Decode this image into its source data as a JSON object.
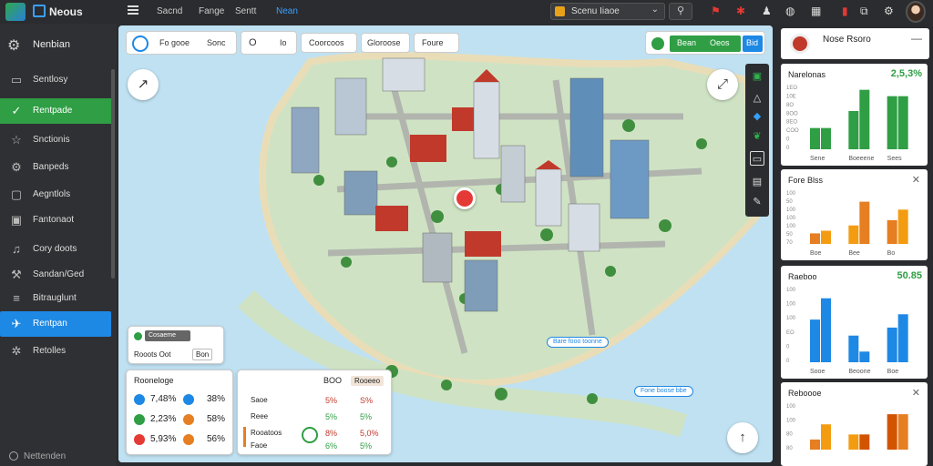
{
  "app": {
    "title": "Neous",
    "logo_color": "#2fa84f",
    "accent": "#1e88e5"
  },
  "topnav": [
    {
      "label": "Sacnd",
      "active": false
    },
    {
      "label": "Fange",
      "active": false
    },
    {
      "label": "Sentt",
      "active": false
    },
    {
      "label": "Nean",
      "active": true
    }
  ],
  "dropdown": {
    "value": "Scenu Iiaoe"
  },
  "sidebar": {
    "header": "Nenbian",
    "items": [
      {
        "label": "Sentlosy",
        "icon": "display-icon",
        "state": "normal"
      },
      {
        "label": "Rentpade",
        "icon": "shield-check-icon",
        "state": "green"
      },
      {
        "label": "Snctionis",
        "icon": "star-icon",
        "state": "normal"
      },
      {
        "label": "Banpeds",
        "icon": "gear-icon",
        "state": "normal"
      },
      {
        "label": "Aegntlols",
        "icon": "frame-icon",
        "state": "normal"
      },
      {
        "label": "Fantonaot",
        "icon": "square-icon",
        "state": "normal"
      },
      {
        "label": "Cory doots",
        "icon": "bell-icon",
        "state": "normal"
      },
      {
        "label": "Sandan/Ged",
        "icon": "tool-icon",
        "state": "normal"
      },
      {
        "label": "Bitrauglunt",
        "icon": "lines-icon",
        "state": "normal"
      },
      {
        "label": "Rentpan",
        "icon": "plane-icon",
        "state": "blue"
      },
      {
        "label": "Retolles",
        "icon": "settings-icon",
        "state": "normal"
      }
    ],
    "footer": "Nettenden"
  },
  "map_toolbar": {
    "pill1": {
      "a": "Fo gooe",
      "b": "Sonc"
    },
    "pill2": {
      "a": "O",
      "b": "Io"
    },
    "pill3": "Coorcoos",
    "pill4": "Gloroose",
    "pill5": "Foure",
    "toggle": {
      "a": "Bean",
      "b": "Oeos",
      "c": "Bid"
    }
  },
  "map_labels": [
    "Bare fooo toonne",
    "Fone boose bbe"
  ],
  "legend_card": {
    "badge": "Cosaeme boos",
    "a": "Rooots Oot",
    "b": "Bon"
  },
  "stats_card": {
    "title": "Rooneloge",
    "rows": [
      {
        "left": "7,48%",
        "right": "38%",
        "icon_left": "#1e88e5",
        "icon_right": "#1e88e5"
      },
      {
        "left": "2,23%",
        "right": "58%",
        "icon_left": "#2f9e44",
        "icon_right": "#e67e22"
      },
      {
        "left": "5,93%",
        "right": "56%",
        "icon_left": "#e53935",
        "icon_right": "#e67e22"
      }
    ]
  },
  "metrics_card": {
    "head_a": "BOO",
    "head_b": "Rooeeo",
    "rows": [
      {
        "label": "Saoe",
        "a": "5%",
        "b": "S%"
      },
      {
        "label": "Reee",
        "a": "5%",
        "b": "5%"
      },
      {
        "label": "Rooatoos",
        "a": "8%",
        "b": "5,0%"
      },
      {
        "label": "Faoe",
        "a": "6%",
        "b": "5%"
      }
    ]
  },
  "right_panel": {
    "header": "Nose Rsoro",
    "cards": [
      {
        "title": "Narelonas",
        "value": "2,5,3%",
        "value_color": "#2f9e44",
        "close": false,
        "chart_data": {
          "type": "bar",
          "categories": [
            "Sene",
            "Boeeene",
            "Sees"
          ],
          "series": [
            {
              "color": "#2f9e44",
              "values": [
                [
                  10,
                  10
                ],
                [
                  18,
                  28
                ],
                [
                  25,
                  25
                ]
              ]
            }
          ],
          "ticks": [
            "1EO",
            "10E",
            "8O",
            "8OO",
            "8EO",
            "COO",
            "0",
            "0"
          ],
          "ylim": [
            0,
            30
          ]
        }
      },
      {
        "title": "Fore Blss",
        "value": "",
        "close": true,
        "chart_data": {
          "type": "bar",
          "categories": [
            "Boe",
            "Bee",
            "Bo",
            "Boe"
          ],
          "series": [
            {
              "colors": [
                "#e67e22",
                "#f39c12"
              ],
              "values": [
                [
                  4,
                  5
                ],
                [
                  7,
                  16
                ],
                [
                  9,
                  13
                ]
              ]
            }
          ],
          "ticks": [
            "100",
            "50",
            "100",
            "100",
            "100",
            "50",
            "70"
          ],
          "ylim": [
            0,
            20
          ]
        }
      },
      {
        "title": "Raeboo",
        "value": "50.85",
        "value_color": "#2f9e44",
        "close": false,
        "chart_data": {
          "type": "bar",
          "categories": [
            "Sooe",
            "Beoone",
            "Boe"
          ],
          "series": [
            {
              "color": "#1e88e5",
              "values": [
                [
                  16,
                  24
                ],
                [
                  10,
                  4
                ],
                [
                  13,
                  18
                ]
              ]
            }
          ],
          "ticks": [
            "100",
            "100",
            "100",
            "EO",
            "0",
            "0"
          ],
          "ylim": [
            0,
            28
          ]
        }
      },
      {
        "title": "Reboooe",
        "value": "",
        "close": true,
        "chart_data": {
          "type": "bar",
          "categories": [
            "",
            "",
            ""
          ],
          "series": [
            {
              "colors": [
                "#e67e22",
                "#f39c12",
                "#d35400"
              ],
              "values": [
                [
                  4,
                  10
                ],
                [
                  6,
                  6
                ],
                [
                  14,
                  14
                ]
              ]
            }
          ],
          "ticks": [
            "100",
            "100",
            "80",
            "80"
          ],
          "ylim": [
            0,
            18
          ]
        }
      }
    ]
  }
}
